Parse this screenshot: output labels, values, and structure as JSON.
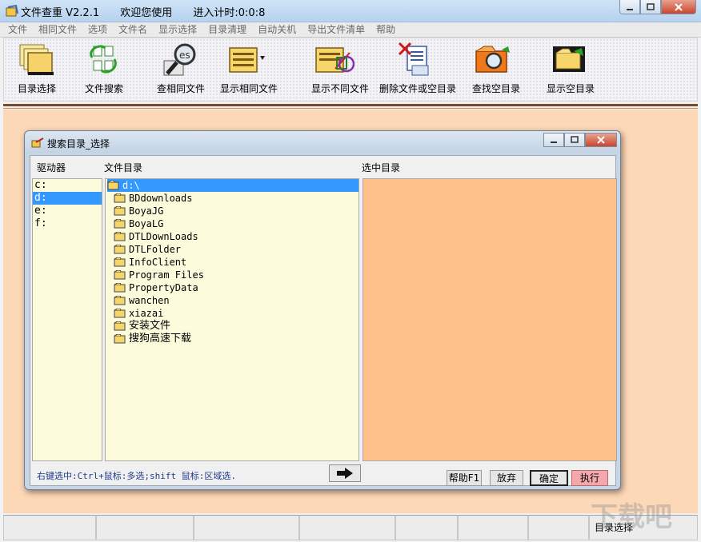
{
  "window": {
    "title": "文件查重 V2.2.1",
    "welcome": "欢迎您使用",
    "timer": "进入计时:0:0:8"
  },
  "menu": [
    "文件",
    "相同文件",
    "选项",
    "文件名",
    "显示选择",
    "目录清理",
    "自动关机",
    "导出文件清单",
    "帮助"
  ],
  "toolbar": [
    {
      "label": "目录选择",
      "icon": "folders-icon"
    },
    {
      "label": "文件搜索",
      "icon": "file-search-icon"
    },
    {
      "label": "查相同文件",
      "icon": "magnifier-icon"
    },
    {
      "label": "显示相同文件",
      "icon": "list-dropdown-icon"
    },
    {
      "label": "显示不同文件",
      "icon": "folder-diff-icon"
    },
    {
      "label": "删除文件或空目录",
      "icon": "delete-file-icon"
    },
    {
      "label": "查找空目录",
      "icon": "find-empty-folder-icon"
    },
    {
      "label": "显示空目录",
      "icon": "show-empty-folder-icon"
    }
  ],
  "dialog": {
    "title": "搜索目录_选择",
    "drive_header": "驱动器",
    "dir_header": "文件目录",
    "selected_header": "选中目录",
    "drives": [
      "c:",
      "d:",
      "e:",
      "f:"
    ],
    "selected_drive": "d:",
    "root_dir": "d:\\",
    "dirs": [
      "BDdownloads",
      "BoyaJG",
      "BoyaLG",
      "DTLDownLoads",
      "DTLFolder",
      "InfoClient",
      "Program Files",
      "PropertyData",
      "wanchen",
      "xiazai",
      "安装文件",
      "搜狗高速下载"
    ],
    "hint": "右键选中:Ctrl+鼠标:多选;shift 鼠标:区域选.",
    "help_btn": "帮助F1",
    "cancel_btn": "放弃",
    "ok_btn": "确定",
    "exec_btn": "执行"
  },
  "status": [
    "",
    "",
    "",
    "",
    "",
    "",
    "",
    "目录选择"
  ],
  "watermark": "下载吧"
}
